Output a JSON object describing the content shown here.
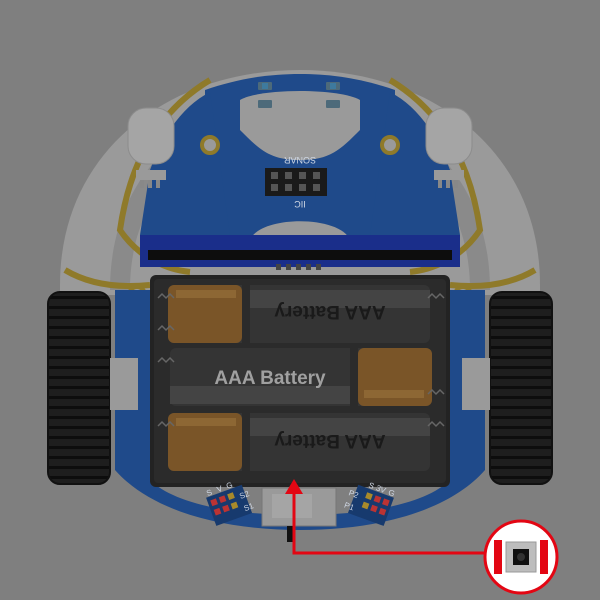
{
  "board": {
    "sonar_label": "SONAR",
    "iic_label": "IIC",
    "battery_label": "AAA Battery",
    "pins_left": {
      "s": "S",
      "v": "V",
      "g": "G",
      "s2": "S2",
      "s1": "S1"
    },
    "pins_right": {
      "s": "S",
      "v3": "3V",
      "g": "G",
      "p2": "P2",
      "p1": "P1"
    }
  },
  "colors": {
    "background": "#7f7f7f",
    "pcb_blue": "#1f4a8a",
    "pcb_dark": "#173a6e",
    "gold_trace": "#8f7a2a",
    "body_white": "#9a9a9a",
    "battery_black": "#2b2b2b",
    "battery_copper": "#7a5528",
    "highlight_red": "#e30613"
  },
  "callout": {
    "icon": "power-switch-icon",
    "arrow_target": "power-switch"
  }
}
